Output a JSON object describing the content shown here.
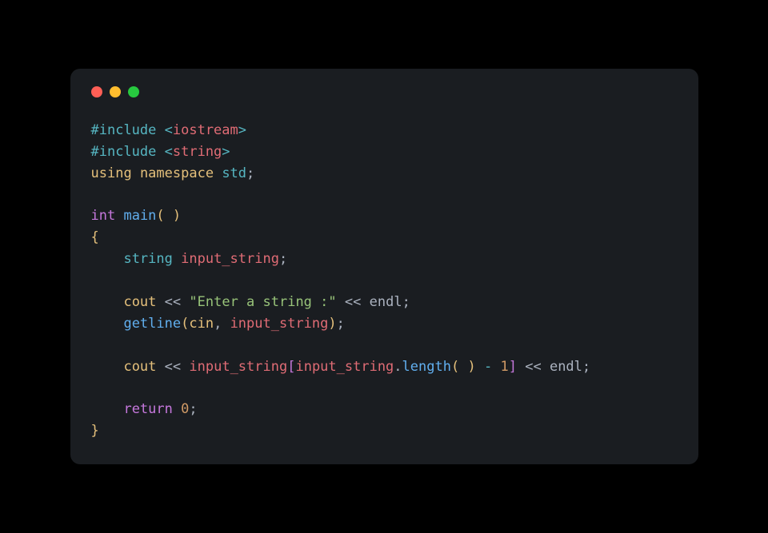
{
  "window": {
    "buttons": [
      "close",
      "minimize",
      "zoom"
    ]
  },
  "code": {
    "lines": [
      {
        "tokens": [
          {
            "cls": "directive",
            "t": "#include "
          },
          {
            "cls": "op",
            "t": "<"
          },
          {
            "cls": "ident",
            "t": "iostream"
          },
          {
            "cls": "op",
            "t": ">"
          }
        ]
      },
      {
        "tokens": [
          {
            "cls": "directive",
            "t": "#include "
          },
          {
            "cls": "op",
            "t": "<"
          },
          {
            "cls": "ident",
            "t": "string"
          },
          {
            "cls": "op",
            "t": ">"
          }
        ]
      },
      {
        "tokens": [
          {
            "cls": "kw-using",
            "t": "using"
          },
          {
            "cls": "punc",
            "t": " "
          },
          {
            "cls": "ns",
            "t": "namespace"
          },
          {
            "cls": "punc",
            "t": " "
          },
          {
            "cls": "std",
            "t": "std"
          },
          {
            "cls": "punc",
            "t": ";"
          }
        ]
      },
      {
        "tokens": [
          {
            "cls": "punc",
            "t": ""
          }
        ]
      },
      {
        "tokens": [
          {
            "cls": "type-int",
            "t": "int"
          },
          {
            "cls": "punc",
            "t": " "
          },
          {
            "cls": "fn",
            "t": "main"
          },
          {
            "cls": "paren",
            "t": "("
          },
          {
            "cls": "punc",
            "t": " "
          },
          {
            "cls": "paren",
            "t": ")"
          }
        ]
      },
      {
        "tokens": [
          {
            "cls": "brace",
            "t": "{"
          }
        ]
      },
      {
        "tokens": [
          {
            "cls": "punc",
            "t": "    "
          },
          {
            "cls": "type",
            "t": "string"
          },
          {
            "cls": "punc",
            "t": " "
          },
          {
            "cls": "ident",
            "t": "input_string"
          },
          {
            "cls": "punc",
            "t": ";"
          }
        ]
      },
      {
        "tokens": [
          {
            "cls": "punc",
            "t": ""
          }
        ]
      },
      {
        "tokens": [
          {
            "cls": "punc",
            "t": "    "
          },
          {
            "cls": "builtin",
            "t": "cout"
          },
          {
            "cls": "punc",
            "t": " "
          },
          {
            "cls": "op-stream",
            "t": "<<"
          },
          {
            "cls": "punc",
            "t": " "
          },
          {
            "cls": "str",
            "t": "\"Enter a string :\""
          },
          {
            "cls": "punc",
            "t": " "
          },
          {
            "cls": "op-stream",
            "t": "<<"
          },
          {
            "cls": "punc",
            "t": " "
          },
          {
            "cls": "endl",
            "t": "endl"
          },
          {
            "cls": "punc",
            "t": ";"
          }
        ]
      },
      {
        "tokens": [
          {
            "cls": "punc",
            "t": "    "
          },
          {
            "cls": "fn",
            "t": "getline"
          },
          {
            "cls": "paren",
            "t": "("
          },
          {
            "cls": "builtin",
            "t": "cin"
          },
          {
            "cls": "punc",
            "t": ", "
          },
          {
            "cls": "ident",
            "t": "input_string"
          },
          {
            "cls": "paren",
            "t": ")"
          },
          {
            "cls": "punc",
            "t": ";"
          }
        ]
      },
      {
        "tokens": [
          {
            "cls": "punc",
            "t": ""
          }
        ]
      },
      {
        "tokens": [
          {
            "cls": "punc",
            "t": "    "
          },
          {
            "cls": "builtin",
            "t": "cout"
          },
          {
            "cls": "punc",
            "t": " "
          },
          {
            "cls": "op-stream",
            "t": "<<"
          },
          {
            "cls": "punc",
            "t": " "
          },
          {
            "cls": "ident",
            "t": "input_string"
          },
          {
            "cls": "bracket",
            "t": "["
          },
          {
            "cls": "ident",
            "t": "input_string"
          },
          {
            "cls": "punc",
            "t": "."
          },
          {
            "cls": "fn",
            "t": "length"
          },
          {
            "cls": "paren",
            "t": "("
          },
          {
            "cls": "punc",
            "t": " "
          },
          {
            "cls": "paren",
            "t": ")"
          },
          {
            "cls": "punc",
            "t": " "
          },
          {
            "cls": "op",
            "t": "-"
          },
          {
            "cls": "punc",
            "t": " "
          },
          {
            "cls": "num",
            "t": "1"
          },
          {
            "cls": "bracket",
            "t": "]"
          },
          {
            "cls": "punc",
            "t": " "
          },
          {
            "cls": "op-stream",
            "t": "<<"
          },
          {
            "cls": "punc",
            "t": " "
          },
          {
            "cls": "endl",
            "t": "endl"
          },
          {
            "cls": "punc",
            "t": ";"
          }
        ]
      },
      {
        "tokens": [
          {
            "cls": "punc",
            "t": ""
          }
        ]
      },
      {
        "tokens": [
          {
            "cls": "punc",
            "t": "    "
          },
          {
            "cls": "kw",
            "t": "return"
          },
          {
            "cls": "punc",
            "t": " "
          },
          {
            "cls": "num",
            "t": "0"
          },
          {
            "cls": "punc",
            "t": ";"
          }
        ]
      },
      {
        "tokens": [
          {
            "cls": "brace",
            "t": "}"
          }
        ]
      }
    ]
  }
}
